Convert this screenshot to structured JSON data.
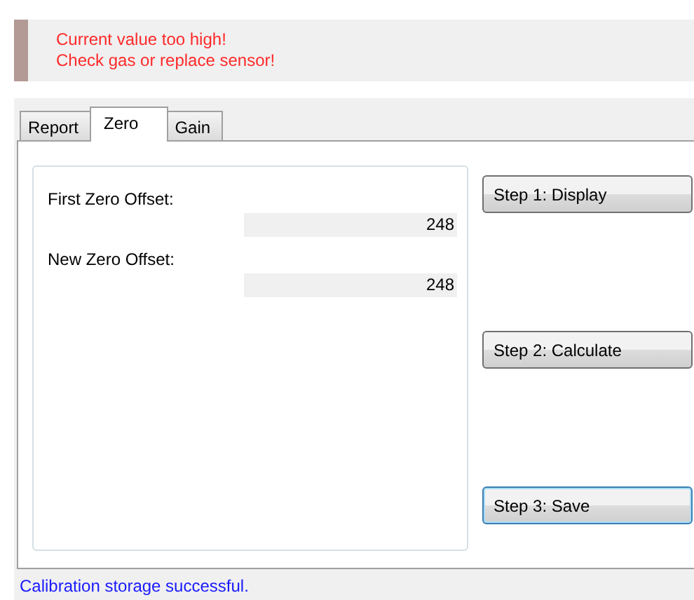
{
  "alert": {
    "lines": [
      "Current value too high!",
      "Check gas or replace sensor!"
    ]
  },
  "tabs": [
    {
      "label": "Report",
      "selected": false
    },
    {
      "label": "Zero",
      "selected": true
    },
    {
      "label": "Gain",
      "selected": false
    }
  ],
  "fields": [
    {
      "label": "First Zero Offset:",
      "value": "248"
    },
    {
      "label": "New Zero Offset:",
      "value": "248"
    }
  ],
  "buttons": [
    {
      "label": "Step 1: Display",
      "focused": false
    },
    {
      "label": "Step 2: Calculate",
      "focused": false
    },
    {
      "label": "Step 3: Save",
      "focused": true
    }
  ],
  "status_bar": "Calibration storage successful."
}
